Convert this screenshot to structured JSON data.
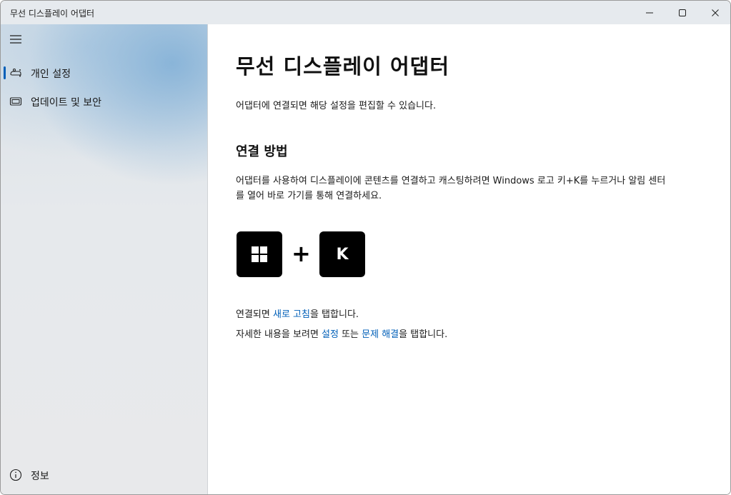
{
  "window": {
    "title": "무선 디스플레이 어댑터"
  },
  "sidebar": {
    "menu_icon": "hamburger-menu-icon",
    "items": [
      {
        "label": "개인 설정",
        "icon": "personalize-icon",
        "selected": true
      },
      {
        "label": "업데이트 및 보안",
        "icon": "update-security-icon",
        "selected": false
      }
    ],
    "footer_item": {
      "label": "정보",
      "icon": "info-icon"
    }
  },
  "main": {
    "title": "무선 디스플레이 어댑터",
    "description": "어댑터에 연결되면 해당 설정을 편집할 수 있습니다.",
    "section_title": "연결 방법",
    "instructions": "어댑터를 사용하여 디스플레이에 콘텐츠를 연결하고 캐스팅하려면 Windows 로고 키+K를 누르거나 알림 센터를 열어 바로 가기를 통해 연결하세요.",
    "shortcut": {
      "key1_icon": "windows-logo-icon",
      "plus": "+",
      "key2": "K"
    },
    "refresh_line": {
      "prefix": "연결되면 ",
      "link": "새로 고침",
      "suffix": "을 탭합니다."
    },
    "details_line": {
      "prefix": "자세한 내용을 보려면 ",
      "link1": "설정",
      "middle": " 또는 ",
      "link2": "문제 해결",
      "suffix": "을 탭합니다."
    }
  },
  "colors": {
    "accent": "#005fb8",
    "key_bg": "#000000"
  }
}
